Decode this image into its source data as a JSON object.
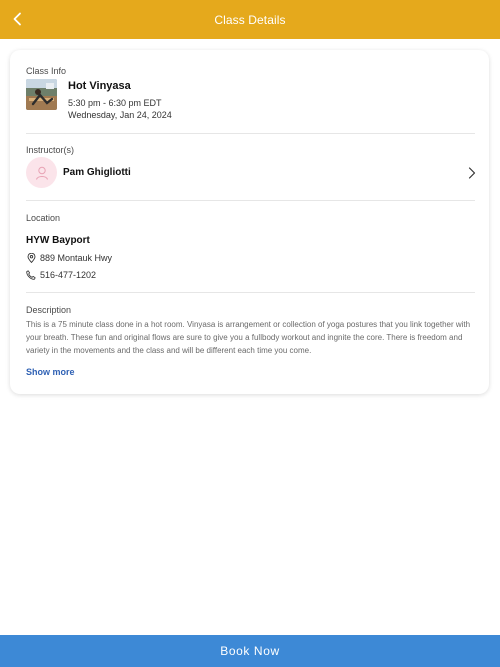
{
  "header": {
    "title": "Class Details",
    "back_icon": "chevron-left-icon",
    "color": "#e5a91c"
  },
  "class_info": {
    "section_label": "Class Info",
    "name": "Hot Vinyasa",
    "time": "5:30 pm - 6:30 pm EDT",
    "date": "Wednesday, Jan 24, 2024"
  },
  "instructor": {
    "section_label": "Instructor(s)",
    "name": "Pam Ghigliotti",
    "avatar_icon": "person-icon"
  },
  "location": {
    "section_label": "Location",
    "name": "HYW Bayport",
    "address": "889 Montauk Hwy",
    "address_icon": "map-pin-icon",
    "phone": "516-477-1202",
    "phone_icon": "phone-icon"
  },
  "description": {
    "section_label": "Description",
    "text": "This is a 75 minute class done in a hot room. Vinyasa is arrangement or collection of yoga postures that you link together with your breath. These fun and original flows are sure to give you a fullbody workout and ingnite the core. There is freedom and variety in the movements and the class and will be different each time you come.",
    "show_more_label": "Show more"
  },
  "footer": {
    "book_label": "Book Now",
    "color": "#3d89d6"
  }
}
